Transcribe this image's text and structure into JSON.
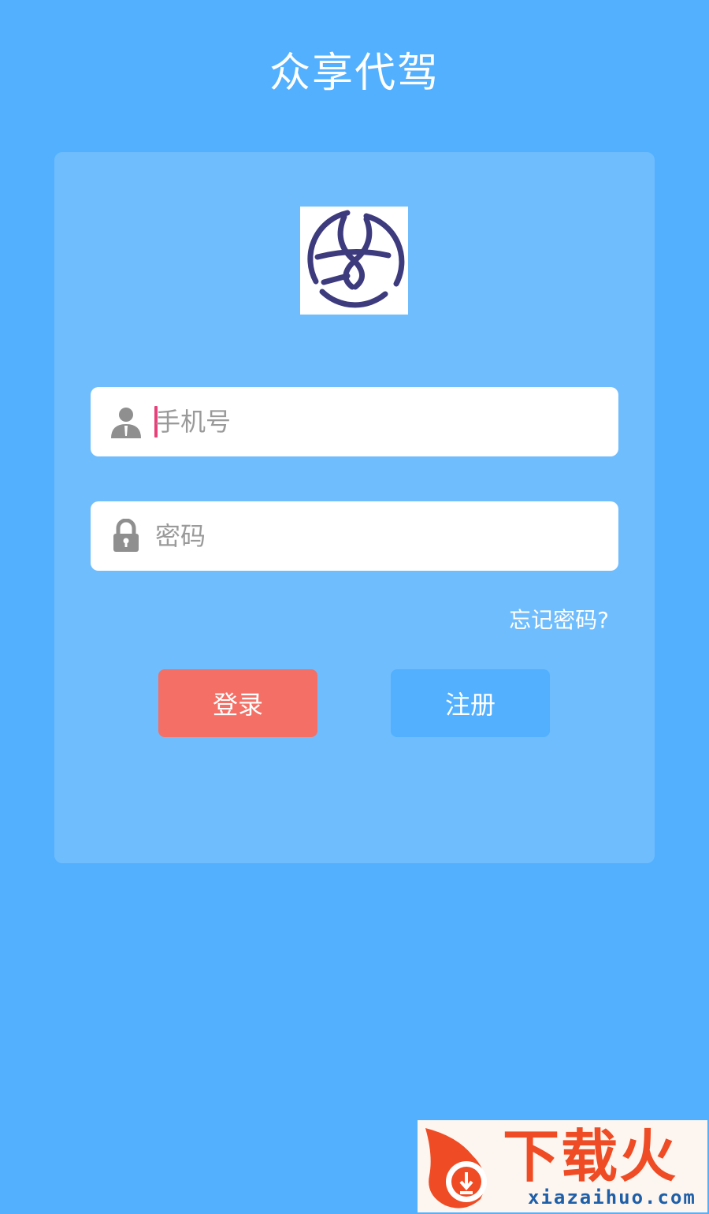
{
  "app": {
    "title": "众享代驾"
  },
  "form": {
    "phone_placeholder": "手机号",
    "password_placeholder": "密码",
    "forgot_password": "忘记密码?",
    "login_label": "登录",
    "register_label": "注册"
  },
  "watermark": {
    "brand": "下载火",
    "domain": "xiazaihuo.com"
  },
  "colors": {
    "background": "#52b0ff",
    "card": "#70bdfd",
    "login_button": "#f46f65",
    "register_button": "#52b0ff",
    "caret": "#e8407a",
    "logo_stroke": "#3d3a7e"
  },
  "icons": {
    "phone": "user-icon",
    "password": "lock-icon",
    "logo": "app-logo-icon"
  }
}
